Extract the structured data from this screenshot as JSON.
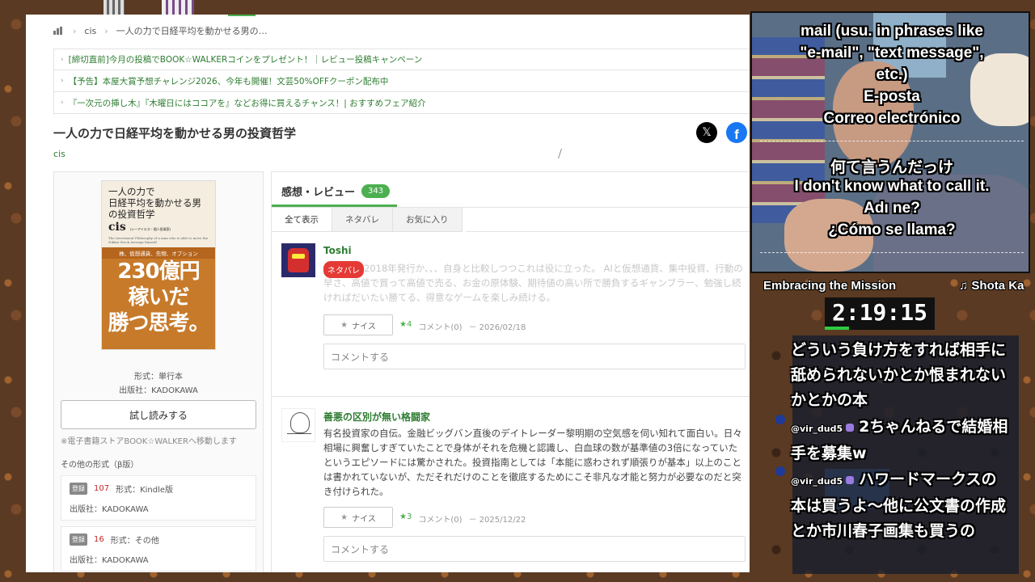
{
  "breadcrumb": {
    "author": "cis",
    "current": "一人の力で日経平均を動かせる男の…"
  },
  "notices": [
    "[締切直前]今月の投稿でBOOK☆WALKERコインをプレゼント！｜レビュー投稿キャンペーン",
    "【予告】本屋大賞予想チャレンジ2026、今年も開催！文芸50%OFFクーポン配布中",
    "『一次元の挿し木』『木曜日にはココアを』などお得に買えるチャンス！| おすすめフェア紹介"
  ],
  "book": {
    "title": "一人の力で日経平均を動かせる男の投資哲学",
    "author": "cis",
    "format_label": "形式：単行本",
    "publisher_label": "出版社：KADOKAWA",
    "trial_button": "試し読みする",
    "trial_note": "※電子書籍ストアBOOK☆WALKERへ移動します",
    "other_formats_label": "その他の形式（β版）",
    "cover": {
      "title_line1": "一人の力で",
      "title_line2": "日経平均を動かせる男",
      "title_line3": "の投資哲学",
      "author": "cis",
      "author_note": "(シーアイエス・個人投資家)",
      "english_title": "The Investment Philosophy of a man who is able to move the Nikkei Stock Average himself",
      "subtitle": "株、仮想通貨、先物、オプション",
      "big_line1": "230億円",
      "big_line2": "稼いだ",
      "big_line3": "勝つ思考。"
    },
    "other_formats": [
      {
        "badge": "登録",
        "count": "107",
        "format": "形式：Kindle版",
        "publisher": "出版社：KADOKAWA"
      },
      {
        "badge": "登録",
        "count": "16",
        "format": "形式：その他",
        "publisher": "出版社：KADOKAWA"
      }
    ]
  },
  "share": {
    "x_icon": "x-logo-icon",
    "facebook_icon": "facebook-logo-icon",
    "x_glyph": "𝕏",
    "facebook_glyph": "f"
  },
  "reviews_section": {
    "heading": "感想・レビュー",
    "count": "343",
    "tabs": [
      "全て表示",
      "ネタバレ",
      "お気に入り"
    ],
    "comment_placeholder": "コメントする",
    "nice_label": "ナイス",
    "items": [
      {
        "user": "Toshi",
        "spoiler_badge": "ネタバレ",
        "text": "2018年発行か、、、自身と比較しつつこれは役に立った。 AIと仮想通貨、集中投資、行動の早さ、高値で買って高値で売る、お金の原体験、期待値の高い所で勝負するギャンブラー、勉強し続ければだいたい勝てる、得意なゲームを楽しみ続ける。",
        "stars": "★4",
        "comments": "コメント(0)",
        "date": "－ 2026/02/18"
      },
      {
        "user": "善悪の区別が無い格闘家",
        "text": "有名投資家の自伝。金融ビッグバン直後のデイトレーダー黎明期の空気感を伺い知れて面白い。日々相場に興奮しすぎていたことで身体がそれを危機と認識し、白血球の数が基準値の3倍になっていたというエピソードには驚かされた。投資指南としては「本能に惑わされず順張りが基本」以上のことは書かれていないが、ただそれだけのことを徹底するためにこそ非凡な才能と努力が必要なのだと突き付けられた。",
        "stars": "★3",
        "comments": "コメント(0)",
        "date": "－ 2025/12/22"
      }
    ]
  },
  "stream": {
    "subtitles_top": [
      "mail (usu. in phrases like",
      "\"e-mail\", \"text message\",",
      "etc.)",
      "E-posta",
      "Correo electrónico"
    ],
    "subtitles_bottom": [
      "何て言うんだっけ",
      "I don't know what to call it.",
      "Adı ne?",
      "¿Cómo se llama?"
    ],
    "now_playing": "Embracing the Mission",
    "now_playing_artist": "♫ Shota Ka",
    "timer": "2:19:15",
    "timer_progress": 0.22,
    "chat": [
      {
        "user": "",
        "text": "どういう負け方をすれば相手に舐められないかとか恨まれないかとかの本"
      },
      {
        "user": "@vir_dud5",
        "text": "2ちゃんねるで結婚相手を募集w"
      },
      {
        "user": "@vir_dud5",
        "text": "ハワードマークスの本は買うよ～他に公文書の作成とか市川春子画集も買うの"
      }
    ]
  }
}
